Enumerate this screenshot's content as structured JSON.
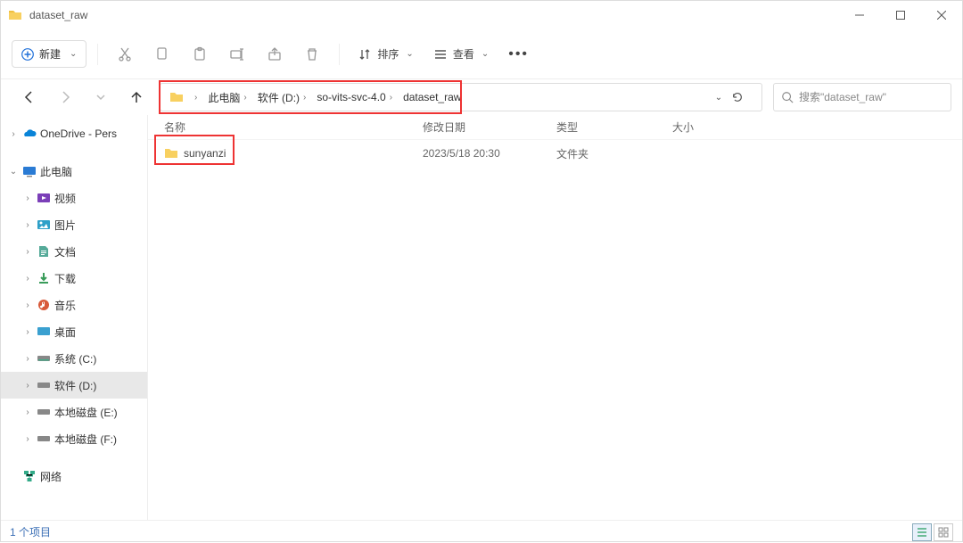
{
  "titlebar": {
    "title": "dataset_raw"
  },
  "toolbar": {
    "new_label": "新建",
    "sort_label": "排序",
    "view_label": "查看"
  },
  "breadcrumbs": [
    "此电脑",
    "软件 (D:)",
    "so-vits-svc-4.0",
    "dataset_raw"
  ],
  "search": {
    "placeholder": "搜索\"dataset_raw\""
  },
  "sidebar": {
    "onedrive": "OneDrive - Pers",
    "this_pc": "此电脑",
    "videos": "视频",
    "pictures": "图片",
    "documents": "文档",
    "downloads": "下载",
    "music": "音乐",
    "desktop": "桌面",
    "sys_c": "系统 (C:)",
    "soft_d": "软件 (D:)",
    "disk_e": "本地磁盘 (E:)",
    "disk_f": "本地磁盘 (F:)",
    "network": "网络"
  },
  "columns": {
    "name": "名称",
    "date": "修改日期",
    "type": "类型",
    "size": "大小"
  },
  "rows": [
    {
      "name": "sunyanzi",
      "date": "2023/5/18 20:30",
      "type": "文件夹",
      "size": ""
    }
  ],
  "status": {
    "count": "1 个项目"
  }
}
